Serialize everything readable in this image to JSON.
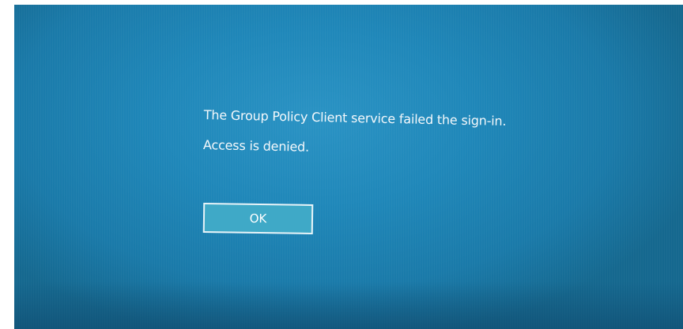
{
  "dialog": {
    "message": "The Group Policy Client service failed the sign-in.",
    "detail": "Access is denied.",
    "ok_label": "OK"
  },
  "colors": {
    "screen_background": "#1f87b9",
    "button_fill": "#3fa9c7",
    "button_border": "#e8f3f8",
    "text": "#f4f8fb"
  }
}
